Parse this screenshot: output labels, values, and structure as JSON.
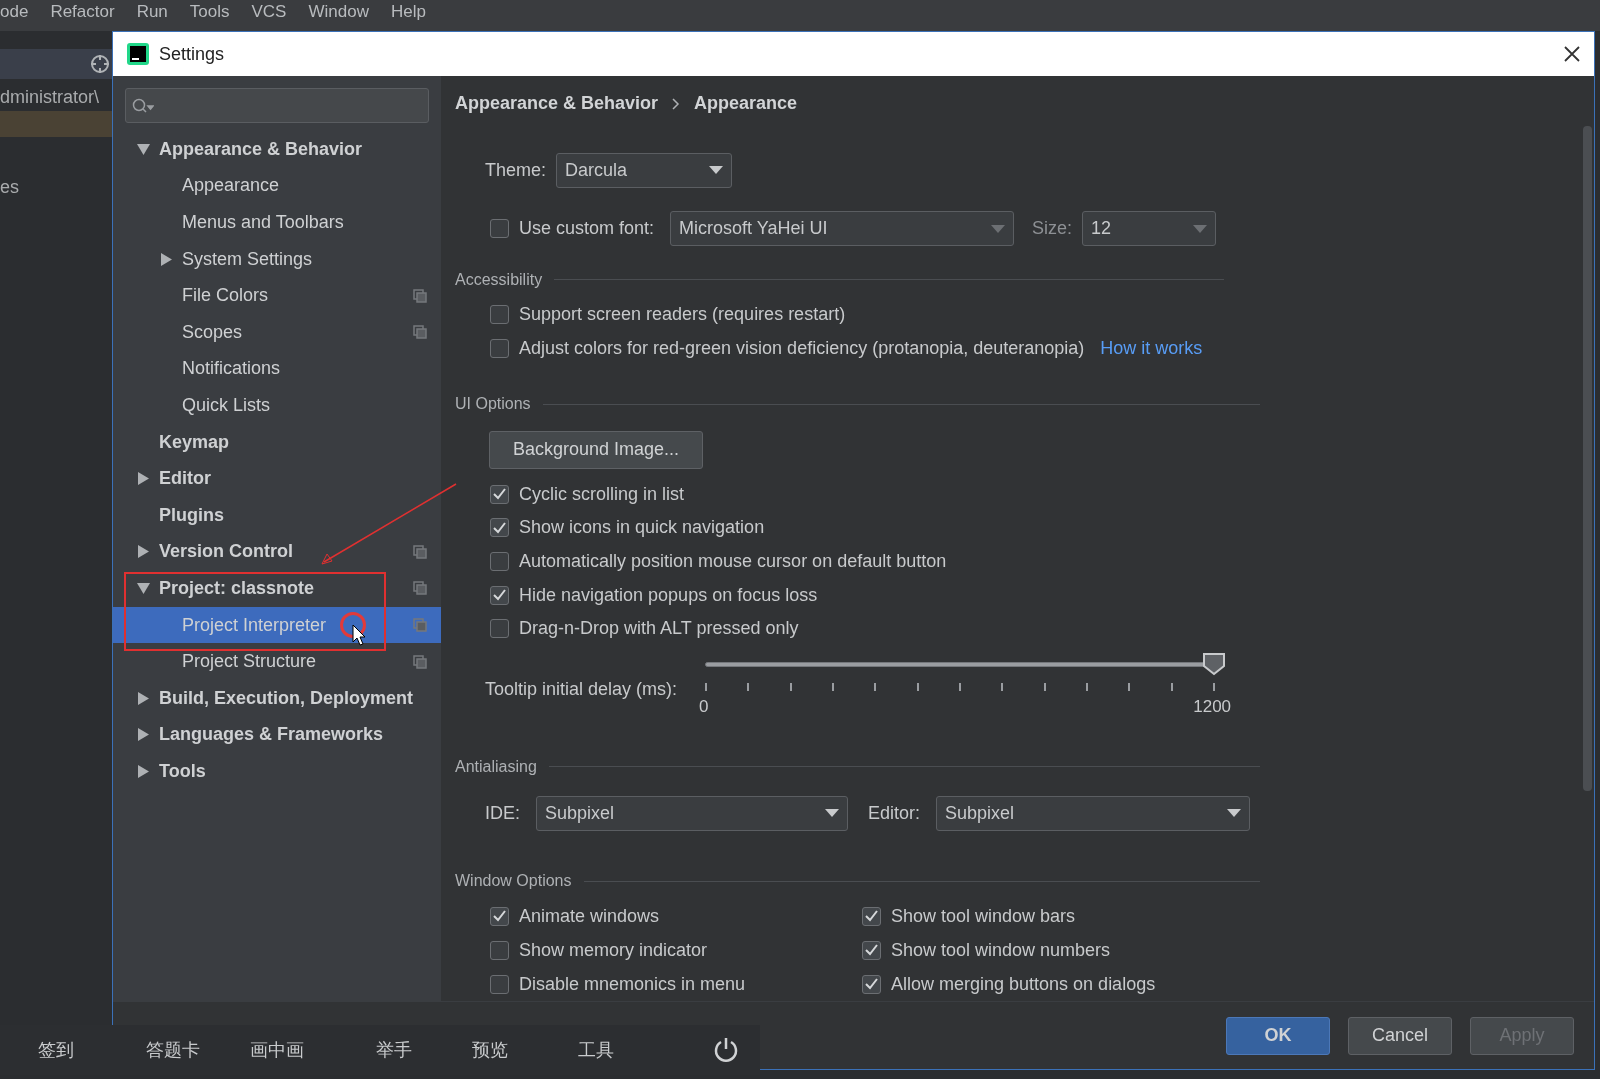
{
  "menu_bar": [
    "ode",
    "Refactor",
    "Run",
    "Tools",
    "VCS",
    "Window",
    "Help"
  ],
  "ide_background": {
    "path_text": "dministrator\\",
    "label": "es"
  },
  "dialog": {
    "title": "Settings",
    "tree": [
      {
        "label": "Appearance & Behavior",
        "expanded": true,
        "selected": false,
        "project_scoped": false,
        "children": [
          {
            "label": "Appearance",
            "selected": false,
            "project_scoped": false
          },
          {
            "label": "Menus and Toolbars",
            "selected": false,
            "project_scoped": false
          },
          {
            "label": "System Settings",
            "expanded": false,
            "selected": false,
            "project_scoped": false
          },
          {
            "label": "File Colors",
            "selected": false,
            "project_scoped": true
          },
          {
            "label": "Scopes",
            "selected": false,
            "project_scoped": true
          },
          {
            "label": "Notifications",
            "selected": false,
            "project_scoped": false
          },
          {
            "label": "Quick Lists",
            "selected": false,
            "project_scoped": false
          }
        ]
      },
      {
        "label": "Keymap",
        "selected": false,
        "project_scoped": false
      },
      {
        "label": "Editor",
        "expanded": false,
        "selected": false,
        "project_scoped": false
      },
      {
        "label": "Plugins",
        "selected": false,
        "project_scoped": false
      },
      {
        "label": "Version Control",
        "expanded": false,
        "selected": false,
        "project_scoped": true
      },
      {
        "label": "Project: classnote",
        "expanded": true,
        "selected": false,
        "project_scoped": true,
        "children": [
          {
            "label": "Project Interpreter",
            "selected": true,
            "project_scoped": true
          },
          {
            "label": "Project Structure",
            "selected": false,
            "project_scoped": true
          }
        ]
      },
      {
        "label": "Build, Execution, Deployment",
        "expanded": false,
        "selected": false,
        "project_scoped": false
      },
      {
        "label": "Languages & Frameworks",
        "expanded": false,
        "selected": false,
        "project_scoped": false
      },
      {
        "label": "Tools",
        "expanded": false,
        "selected": false,
        "project_scoped": false
      }
    ],
    "breadcrumb": [
      "Appearance & Behavior",
      "Appearance"
    ],
    "theme": {
      "label": "Theme:",
      "value": "Darcula"
    },
    "custom_font": {
      "label": "Use custom font:",
      "checked": false,
      "font": "Microsoft YaHei UI",
      "size_label": "Size:",
      "size": "12"
    },
    "accessibility": {
      "title": "Accessibility",
      "options": [
        {
          "label": "Support screen readers (requires restart)",
          "checked": false
        },
        {
          "label": "Adjust colors for red-green vision deficiency (protanopia, deuteranopia)",
          "checked": false,
          "link": "How it works"
        }
      ]
    },
    "ui_options": {
      "title": "UI Options",
      "button": "Background Image...",
      "options": [
        {
          "label": "Cyclic scrolling in list",
          "checked": true
        },
        {
          "label": "Show icons in quick navigation",
          "checked": true
        },
        {
          "label": "Automatically position mouse cursor on default button",
          "checked": false
        },
        {
          "label": "Hide navigation popups on focus loss",
          "checked": true
        },
        {
          "label": "Drag-n-Drop with ALT pressed only",
          "checked": false
        }
      ],
      "tooltip_delay": {
        "label": "Tooltip initial delay (ms):",
        "level": 1,
        "min_label": "0",
        "max_label": "1200"
      }
    },
    "antialiasing": {
      "title": "Antialiasing",
      "ide_label": "IDE:",
      "ide_value": "Subpixel",
      "editor_label": "Editor:",
      "editor_value": "Subpixel"
    },
    "window_options": {
      "title": "Window Options",
      "columns": [
        [
          {
            "label": "Animate windows",
            "checked": true
          },
          {
            "label": "Show memory indicator",
            "checked": false
          },
          {
            "label": "Disable mnemonics in menu",
            "checked": false
          }
        ],
        [
          {
            "label": "Show tool window bars",
            "checked": true
          },
          {
            "label": "Show tool window numbers",
            "checked": true
          },
          {
            "label": "Allow merging buttons on dialogs",
            "checked": true
          }
        ]
      ]
    },
    "buttons": [
      {
        "label": "OK",
        "default": true,
        "disabled": false
      },
      {
        "label": "Cancel",
        "default": false,
        "disabled": false
      },
      {
        "label": "Apply",
        "default": false,
        "disabled": true
      }
    ]
  },
  "class_toolbar": {
    "items": [
      "签到",
      "答题卡",
      "画中画",
      "举手",
      "预览",
      "工具"
    ]
  }
}
